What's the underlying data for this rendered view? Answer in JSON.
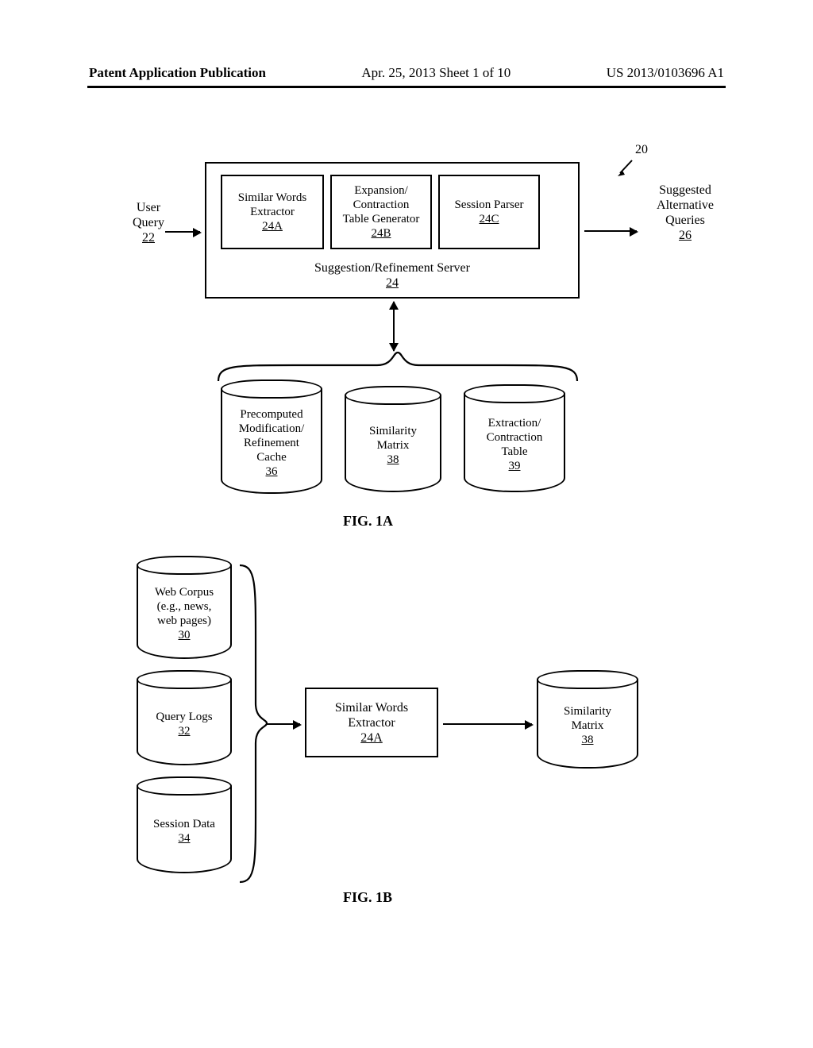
{
  "header": {
    "pubtype": "Patent Application Publication",
    "date_sheet": "Apr. 25, 2013  Sheet 1 of 10",
    "patno": "US 2013/0103696 A1"
  },
  "fig1a": {
    "ref20": "20",
    "user_query": {
      "line1": "User",
      "line2": "Query",
      "ref": "22"
    },
    "suggested": {
      "line1": "Suggested",
      "line2": "Alternative",
      "line3": "Queries",
      "ref": "26"
    },
    "server": {
      "line1": "Suggestion/Refinement Server",
      "ref": "24"
    },
    "swe": {
      "line1": "Similar Words",
      "line2": "Extractor",
      "ref": "24A"
    },
    "ect": {
      "line1": "Expansion/",
      "line2": "Contraction",
      "line3": "Table Generator",
      "ref": "24B"
    },
    "sp": {
      "line1": "Session Parser",
      "ref": "24C"
    },
    "pmr": {
      "line1": "Precomputed",
      "line2": "Modification/",
      "line3": "Refinement",
      "line4": "Cache",
      "ref": "36"
    },
    "sim": {
      "line1": "Similarity",
      "line2": "Matrix",
      "ref": "38"
    },
    "ectbl": {
      "line1": "Extraction/",
      "line2": "Contraction",
      "line3": "Table",
      "ref": "39"
    },
    "caption": "FIG. 1A"
  },
  "fig1b": {
    "wc": {
      "line1": "Web Corpus",
      "line2": "(e.g., news,",
      "line3": "web pages)",
      "ref": "30"
    },
    "ql": {
      "line1": "Query Logs",
      "ref": "32"
    },
    "sd": {
      "line1": "Session Data",
      "ref": "34"
    },
    "swe": {
      "line1": "Similar Words",
      "line2": "Extractor",
      "ref": "24A"
    },
    "sim": {
      "line1": "Similarity",
      "line2": "Matrix",
      "ref": "38"
    },
    "caption": "FIG. 1B"
  }
}
